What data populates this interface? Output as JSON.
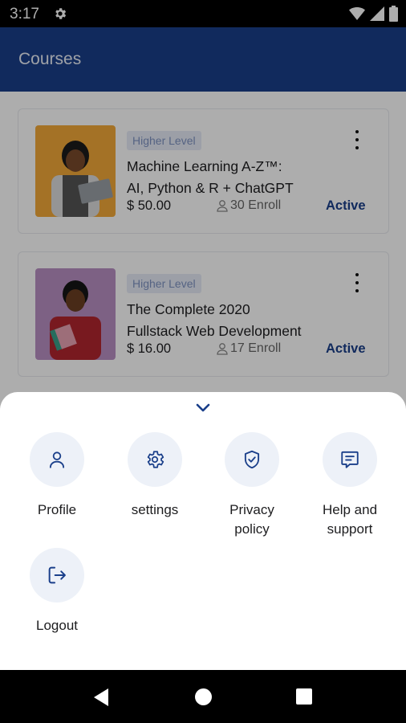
{
  "status_bar": {
    "time": "3:17"
  },
  "app_bar": {
    "title": "Courses"
  },
  "courses": [
    {
      "level": "Higher Level",
      "title_line1": "Machine Learning A-Z™:",
      "title_line2": "AI, Python & R + ChatGPT",
      "price": "$ 50.00",
      "enroll": "30 Enroll",
      "status": "Active"
    },
    {
      "level": "Higher Level",
      "title_line1": "The Complete 2020",
      "title_line2": "Fullstack Web Development",
      "price": "$ 16.00",
      "enroll": "17 Enroll",
      "status": "Active"
    }
  ],
  "menu": {
    "profile": "Profile",
    "settings": "settings",
    "privacy_line1": "Privacy",
    "privacy_line2": "policy",
    "help_line1": "Help and",
    "help_line2": "support",
    "logout": "Logout"
  },
  "colors": {
    "primary": "#1a3f8a",
    "icon_circle": "#edf1f8"
  }
}
